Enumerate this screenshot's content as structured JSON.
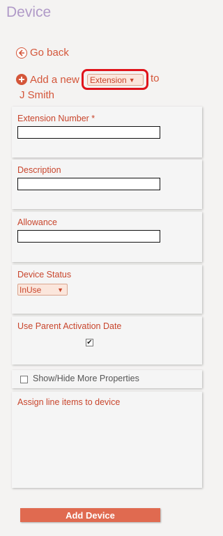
{
  "page": {
    "title": "Device"
  },
  "nav": {
    "go_back": "Go back"
  },
  "add": {
    "prefix": "Add a new",
    "device_type_selected": "Extension",
    "suffix": "to",
    "owner": "J Smith"
  },
  "fields": {
    "extension_number_label": "Extension Number *",
    "extension_number_value": "",
    "description_label": "Description",
    "description_value": "",
    "allowance_label": "Allowance",
    "allowance_value": "",
    "device_status_label": "Device Status",
    "device_status_selected": "InUse",
    "use_parent_activation_label": "Use Parent Activation Date",
    "use_parent_activation_checked": true
  },
  "more_properties": {
    "label": "Show/Hide More Properties",
    "checked": false
  },
  "line_items": {
    "label": "Assign line items to device"
  },
  "submit": {
    "label": "Add Device"
  },
  "colors": {
    "accent": "#d4563a",
    "title": "#b09ac8",
    "button": "#e06a50",
    "highlight": "#e0141c"
  }
}
